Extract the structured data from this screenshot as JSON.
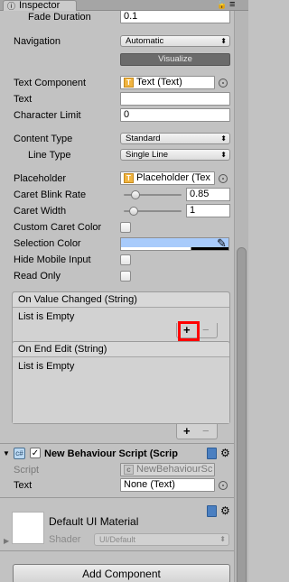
{
  "window": {
    "tab_label": "Inspector",
    "tab_icon": "info-icon",
    "lock_icon": "lock-icon",
    "menu_icon": "context-menu-icon"
  },
  "input_field": {
    "fade_duration": {
      "label": "Fade Duration",
      "value": "0.1"
    },
    "navigation": {
      "label": "Navigation",
      "value": "Automatic",
      "visualize_label": "Visualize"
    },
    "text_component": {
      "label": "Text Component",
      "value": "Text (Text)"
    },
    "text": {
      "label": "Text",
      "value": ""
    },
    "character_limit": {
      "label": "Character Limit",
      "value": "0"
    },
    "content_type": {
      "label": "Content Type",
      "value": "Standard"
    },
    "line_type": {
      "label": "Line Type",
      "value": "Single Line"
    },
    "placeholder": {
      "label": "Placeholder",
      "value": "Placeholder (Tex"
    },
    "caret_blink_rate": {
      "label": "Caret Blink Rate",
      "value": "0.85",
      "fraction": 0.21
    },
    "caret_width": {
      "label": "Caret Width",
      "value": "1",
      "fraction": 0.17
    },
    "custom_caret_color": {
      "label": "Custom Caret Color",
      "checked": false
    },
    "selection_color": {
      "label": "Selection Color",
      "color": "#a8cbfb",
      "alpha": 0.65
    },
    "hide_mobile_input": {
      "label": "Hide Mobile Input",
      "checked": false
    },
    "read_only": {
      "label": "Read Only",
      "checked": false
    }
  },
  "events": [
    {
      "header": "On Value Changed (String)",
      "body": "List is Empty",
      "add_label": "+",
      "remove_label": "−",
      "add_highlighted": true
    },
    {
      "header": "On End Edit (String)",
      "body": "List is Empty",
      "add_label": "+",
      "remove_label": "−",
      "add_highlighted": false
    }
  ],
  "behaviour": {
    "title": "New Behaviour Script (Scrip",
    "enabled": true,
    "script_label": "Script",
    "script_value": "NewBehaviourSc",
    "text_label": "Text",
    "text_value": "None (Text)"
  },
  "material": {
    "title": "Default UI Material",
    "shader_label": "Shader",
    "shader_value": "UI/Default"
  },
  "add_component_label": "Add Component",
  "colors": {
    "highlight": "#ff0000",
    "panel_bg": "#c2c2c2",
    "selection_color": "#a8cbfb"
  }
}
